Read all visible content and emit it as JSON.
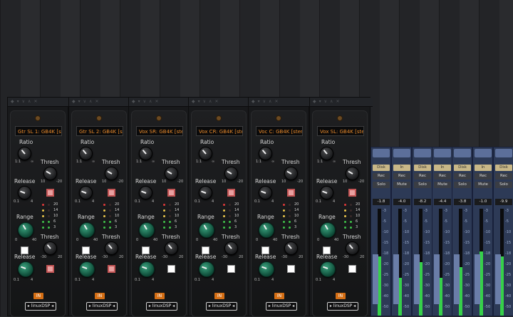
{
  "colors": {
    "accent": "#e88a2c",
    "meter": "#36d04a",
    "mixer": "#2d3a56"
  },
  "plugin": {
    "ratio_label": "Ratio",
    "thresh_label": "Thresh",
    "release_label": "Release",
    "range_label": "Range",
    "ratio_min": "1:1",
    "ratio_max": "∞",
    "thresh_min": "10",
    "thresh_max": "-20",
    "release_min": "0.1",
    "release_max": "4",
    "range_min": "0",
    "range_max": "40",
    "thresh2_min": "-30",
    "thresh2_max": "20",
    "release2_min": "0.1",
    "release2_max": "4",
    "led_labels": [
      "20",
      "14",
      "10",
      "6",
      "3"
    ],
    "brand": "▸ linuxDSP ◂",
    "in_label": "IN"
  },
  "strips": [
    {
      "name": "Gtr SL 1: GB4K [ste"
    },
    {
      "name": "Gtr SL 2: GB4K [ste"
    },
    {
      "name": "Vox SR: GB4K [ste"
    },
    {
      "name": "Vox CR: GB4K [ste"
    },
    {
      "name": "Voc C: GB4K [stere"
    },
    {
      "name": "Vox SL: GB4K [ste"
    }
  ],
  "mixers": [
    {
      "b1": "Disk",
      "b2": "Rec",
      "b3": "Solo",
      "b4": "",
      "value": "-1.8",
      "level": 0.55
    },
    {
      "b1": "In",
      "b2": "Rec",
      "b3": "Mute",
      "b4": "",
      "value": "-4.0",
      "level": 0.35
    },
    {
      "b1": "Disk",
      "b2": "Rec",
      "b3": "Solo",
      "b4": "",
      "value": "-8.2",
      "level": 0.5
    },
    {
      "b1": "In",
      "b2": "Rec",
      "b3": "Mute",
      "b4": "",
      "value": "-4.4",
      "level": 0.35
    },
    {
      "b1": "Disk",
      "b2": "Rec",
      "b3": "Solo",
      "b4": "",
      "value": "-3.8",
      "level": 0.45
    },
    {
      "b1": "In",
      "b2": "Rec",
      "b3": "Mute",
      "b4": "",
      "value": "-1.0",
      "level": 0.6
    },
    {
      "b1": "Disk",
      "b2": "Rec",
      "b3": "Solo",
      "b4": "",
      "value": "-9.9",
      "level": 0.55
    }
  ],
  "scale_ticks": [
    "-3",
    "-5",
    "-10",
    "-15",
    "-18",
    "-20",
    "-25",
    "-30",
    "-40",
    "-50"
  ]
}
